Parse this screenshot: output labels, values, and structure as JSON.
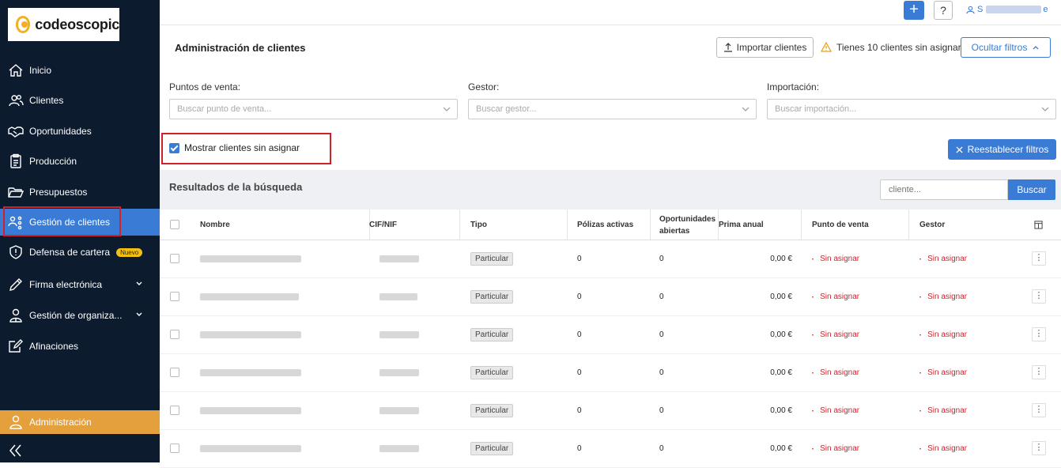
{
  "brand": {
    "logo_text": "codeoscopic",
    "accent": "#3a7bd5",
    "sidebar_bg": "#0d1b2e",
    "admin_color": "#e4a03c",
    "alert_red": "#d0212a"
  },
  "sidebar": {
    "items": [
      {
        "label": "Inicio",
        "icon": "home-icon"
      },
      {
        "label": "Clientes",
        "icon": "users-icon"
      },
      {
        "label": "Oportunidades",
        "icon": "handshake-icon"
      },
      {
        "label": "Producción",
        "icon": "clipboard-icon"
      },
      {
        "label": "Presupuestos",
        "icon": "folder-icon"
      },
      {
        "label": "Gestión de clientes",
        "icon": "client-network-icon",
        "active": true
      },
      {
        "label": "Defensa de cartera",
        "icon": "shield-icon",
        "badge": "Nuevo"
      },
      {
        "label": "Firma electrónica",
        "icon": "pen-icon",
        "expandable": true
      },
      {
        "label": "Gestión de organiza...",
        "icon": "org-user-icon",
        "expandable": true
      },
      {
        "label": "Afinaciones",
        "icon": "edit-icon"
      }
    ],
    "admin_label": "Administración"
  },
  "topbar": {
    "plus": "+",
    "help": "?",
    "user_initial": "S",
    "user_suffix": "e"
  },
  "header": {
    "title": "Administración de clientes",
    "import_label": "Importar clientes",
    "warning_text": "Tienes 10 clientes sin asignar",
    "toggle_filters_label": "Ocultar filtros"
  },
  "filters": {
    "points_label": "Puntos de venta:",
    "points_placeholder": "Buscar punto de venta...",
    "manager_label": "Gestor:",
    "manager_placeholder": "Buscar gestor...",
    "import_label": "Importación:",
    "import_placeholder": "Buscar importación...",
    "show_unassigned_label": "Mostrar clientes sin asignar",
    "show_unassigned_checked": true,
    "reset_label": "Reestablecer filtros"
  },
  "results": {
    "title": "Resultados de la búsqueda",
    "search_placeholder": "cliente...",
    "search_button": "Buscar",
    "columns": {
      "name": "Nombre",
      "cif": "CIF/NIF",
      "type": "Tipo",
      "policies": "Pólizas activas",
      "opps_line1": "Oportunidades",
      "opps_line2": "abiertas",
      "premium": "Prima anual",
      "pos": "Punto de venta",
      "manager": "Gestor"
    },
    "rows": [
      {
        "tipo": "Particular",
        "polizas": "0",
        "oportunidades": "0",
        "prima": "0,00 €",
        "punto": "Sin asignar",
        "gestor": "Sin asignar"
      },
      {
        "tipo": "Particular",
        "polizas": "0",
        "oportunidades": "0",
        "prima": "0,00 €",
        "punto": "Sin asignar",
        "gestor": "Sin asignar"
      },
      {
        "tipo": "Particular",
        "polizas": "0",
        "oportunidades": "0",
        "prima": "0,00 €",
        "punto": "Sin asignar",
        "gestor": "Sin asignar"
      },
      {
        "tipo": "Particular",
        "polizas": "0",
        "oportunidades": "0",
        "prima": "0,00 €",
        "punto": "Sin asignar",
        "gestor": "Sin asignar"
      },
      {
        "tipo": "Particular",
        "polizas": "0",
        "oportunidades": "0",
        "prima": "0,00 €",
        "punto": "Sin asignar",
        "gestor": "Sin asignar"
      },
      {
        "tipo": "Particular",
        "polizas": "0",
        "oportunidades": "0",
        "prima": "0,00 €",
        "punto": "Sin asignar",
        "gestor": "Sin asignar"
      }
    ]
  }
}
